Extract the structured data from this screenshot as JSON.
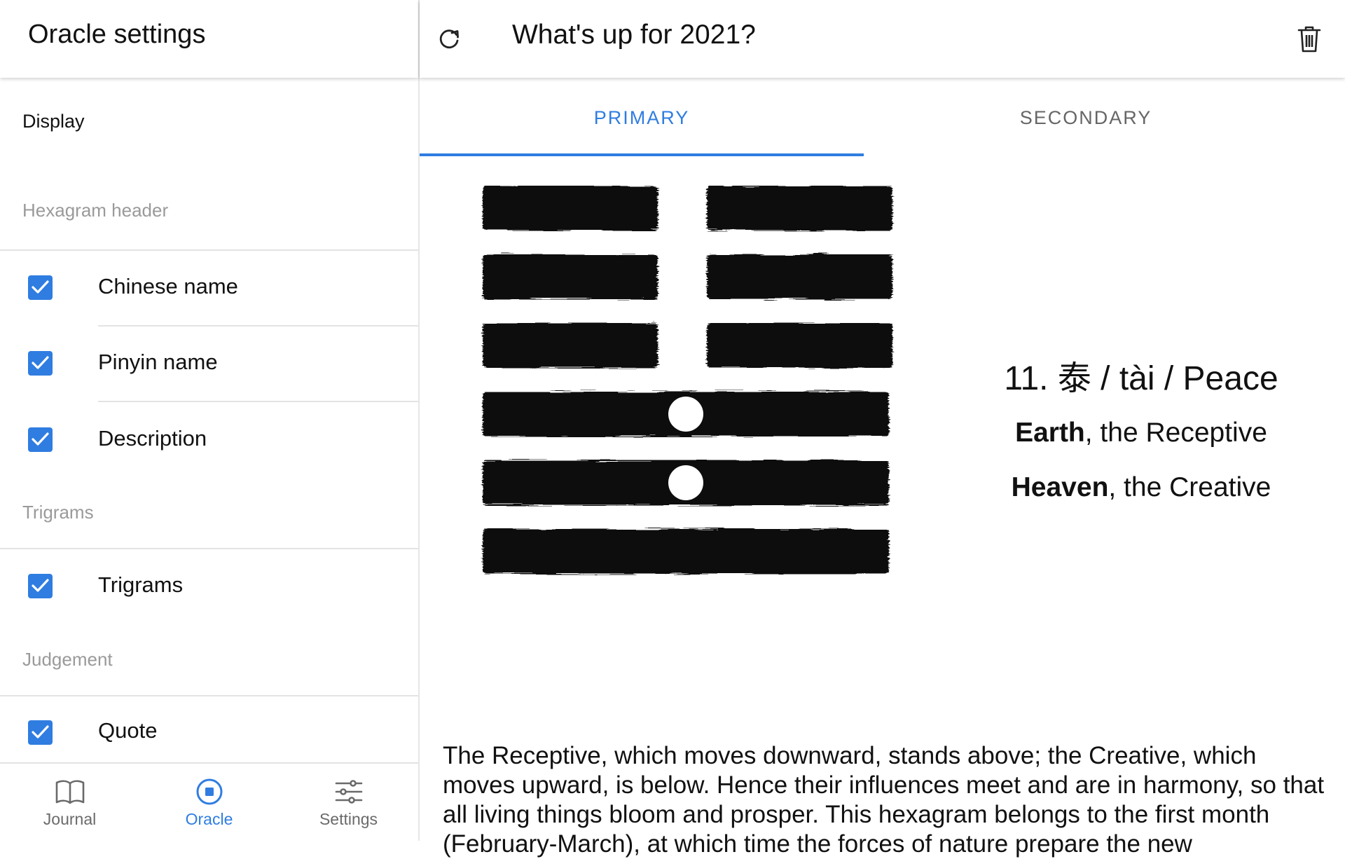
{
  "left_panel": {
    "title": "Oracle settings",
    "display_label": "Display",
    "sections": [
      {
        "title": "Hexagram header",
        "items": [
          {
            "label": "Chinese name",
            "checked": true
          },
          {
            "label": "Pinyin name",
            "checked": true
          },
          {
            "label": "Description",
            "checked": true
          }
        ]
      },
      {
        "title": "Trigrams",
        "items": [
          {
            "label": "Trigrams",
            "checked": true
          }
        ]
      },
      {
        "title": "Judgement",
        "items": [
          {
            "label": "Quote",
            "checked": true
          }
        ]
      }
    ]
  },
  "bottom_nav": {
    "items": [
      {
        "label": "Journal",
        "icon": "book-icon",
        "active": false
      },
      {
        "label": "Oracle",
        "icon": "oracle-icon",
        "active": true
      },
      {
        "label": "Settings",
        "icon": "sliders-icon",
        "active": false
      }
    ]
  },
  "reading": {
    "question": "What's up for 2021?",
    "tabs": [
      {
        "label": "PRIMARY",
        "active": true
      },
      {
        "label": "SECONDARY",
        "active": false
      }
    ],
    "hexagram": {
      "number_name": "11. 泰 / tài / Peace",
      "upper_trigram": {
        "name": "Earth",
        "rest": ", the Receptive"
      },
      "lower_trigram": {
        "name": "Heaven",
        "rest": ", the Creative"
      },
      "lines_top_to_bottom": [
        {
          "type": "yin",
          "changing": false
        },
        {
          "type": "yin",
          "changing": false
        },
        {
          "type": "yin",
          "changing": false
        },
        {
          "type": "yang",
          "changing": true
        },
        {
          "type": "yang",
          "changing": true
        },
        {
          "type": "yang",
          "changing": false
        }
      ]
    },
    "description": "The Receptive, which moves downward, stands above; the Creative, which moves upward, is below. Hence their influences meet and are in harmony, so that all living things bloom and prosper. This hexagram belongs to the first month (February-March), at which time the forces of nature prepare the new"
  },
  "colors": {
    "accent": "#2f7de1",
    "ink": "#111111",
    "muted": "#9a9a9a"
  }
}
